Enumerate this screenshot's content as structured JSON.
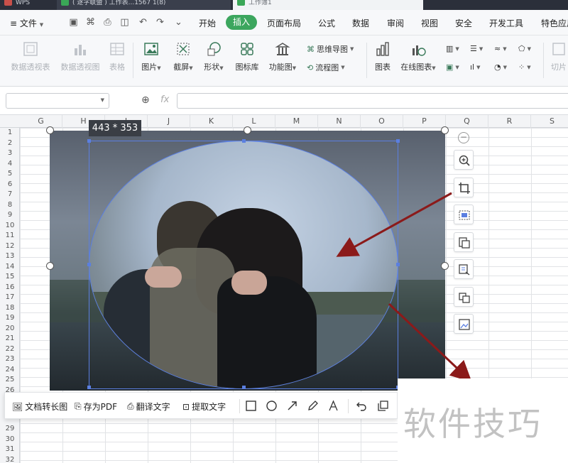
{
  "titlebar": {
    "tabs": [
      {
        "label": "WPS",
        "name": "tab-wps"
      },
      {
        "label": "( 逐字联盟 ) 工作表...1567 1(8)",
        "name": "tab-doc"
      },
      {
        "label": "工作簿1",
        "name": "tab-sheet"
      }
    ]
  },
  "menubar": {
    "file_label": "文件",
    "items": [
      "开始",
      "插入",
      "页面布局",
      "公式",
      "数据",
      "审阅",
      "视图",
      "安全",
      "开发工具",
      "特色应用"
    ],
    "active_index": 1,
    "accent_color": "#3ca65e"
  },
  "ribbon": {
    "pivot_table": "数据透视表",
    "pivot_chart": "数据透视图",
    "table": "表格",
    "picture": "图片",
    "screenshot": "截屏",
    "shape": "形状",
    "icon_lib": "图标库",
    "func_chart": "功能图",
    "mindmap": "思维导图",
    "flowchart": "流程图",
    "chart": "图表",
    "online_chart": "在线图表",
    "slice": "切片"
  },
  "formulabar": {
    "fx_label": "fx"
  },
  "grid": {
    "columns": [
      "G",
      "H",
      "I",
      "J",
      "K",
      "L",
      "M",
      "N",
      "O",
      "P",
      "Q",
      "R",
      "S"
    ],
    "rows": [
      "1",
      "2",
      "3",
      "4",
      "5",
      "6",
      "7",
      "8",
      "9",
      "10",
      "11",
      "12",
      "13",
      "14",
      "15",
      "16",
      "17",
      "18",
      "19",
      "20",
      "21",
      "22",
      "23",
      "24",
      "25",
      "26",
      "27",
      "28",
      "29",
      "30",
      "31",
      "32"
    ]
  },
  "image": {
    "size_tip": "443 * 353",
    "selection_color": "#5b7fe0"
  },
  "sidetools": {
    "icons": [
      "zoom-in-icon",
      "crop-icon",
      "crop-fit-icon",
      "picture-to-pdf-icon",
      "translate-icon",
      "image-compare-icon",
      "image-combine-icon"
    ]
  },
  "bottombar": {
    "long_image": "文档转长图",
    "save_pdf": "存为PDF",
    "translate": "翻译文字",
    "extract_text": "提取文字"
  },
  "watermark": "软件技巧",
  "annotation_color": "#8b1a1a"
}
